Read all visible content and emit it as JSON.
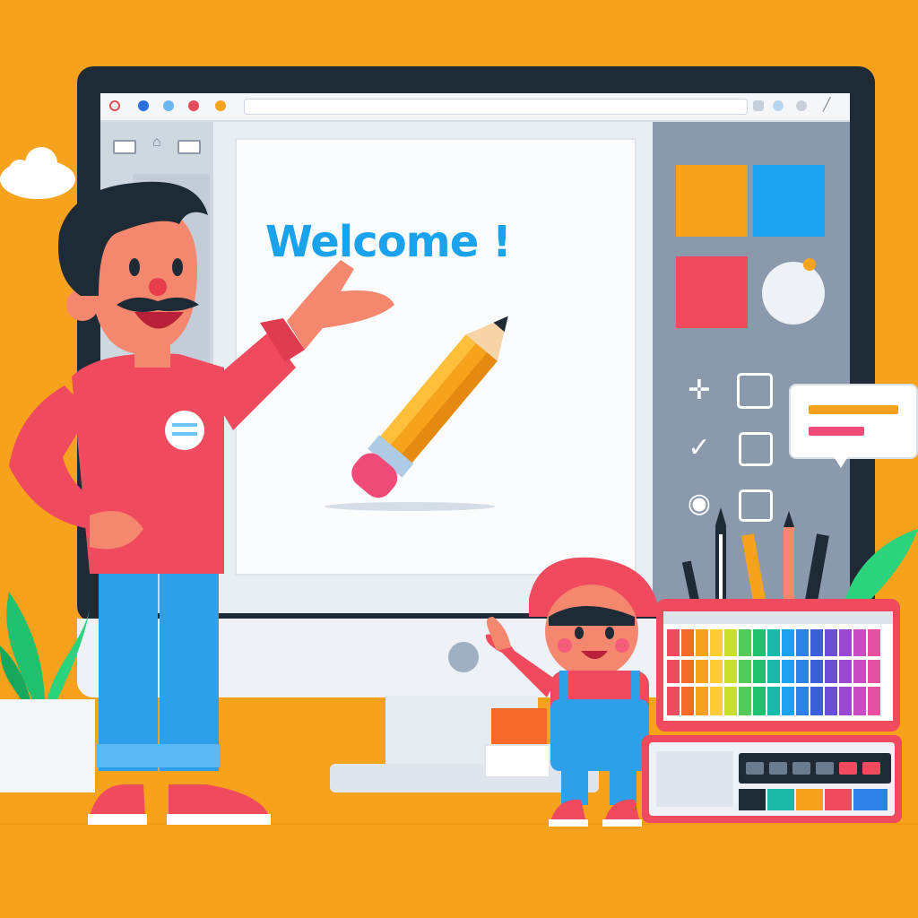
{
  "canvas": {
    "heading": "Welcome !"
  },
  "colors": {
    "background": "#f7a21c",
    "accent_blue": "#1aa3ec",
    "swatch_orange": "#f7a21c",
    "swatch_blue": "#1aa3ec",
    "swatch_red": "#f04a5e",
    "shirt_red": "#f04a5e",
    "jeans_blue": "#2e9fea",
    "pencil_orange": "#f7a21c"
  },
  "icons": [
    "move-icon",
    "select-crop-icon",
    "check-icon",
    "square-icon",
    "circle-target-icon",
    "image-icon",
    "color-wheel-icon"
  ]
}
